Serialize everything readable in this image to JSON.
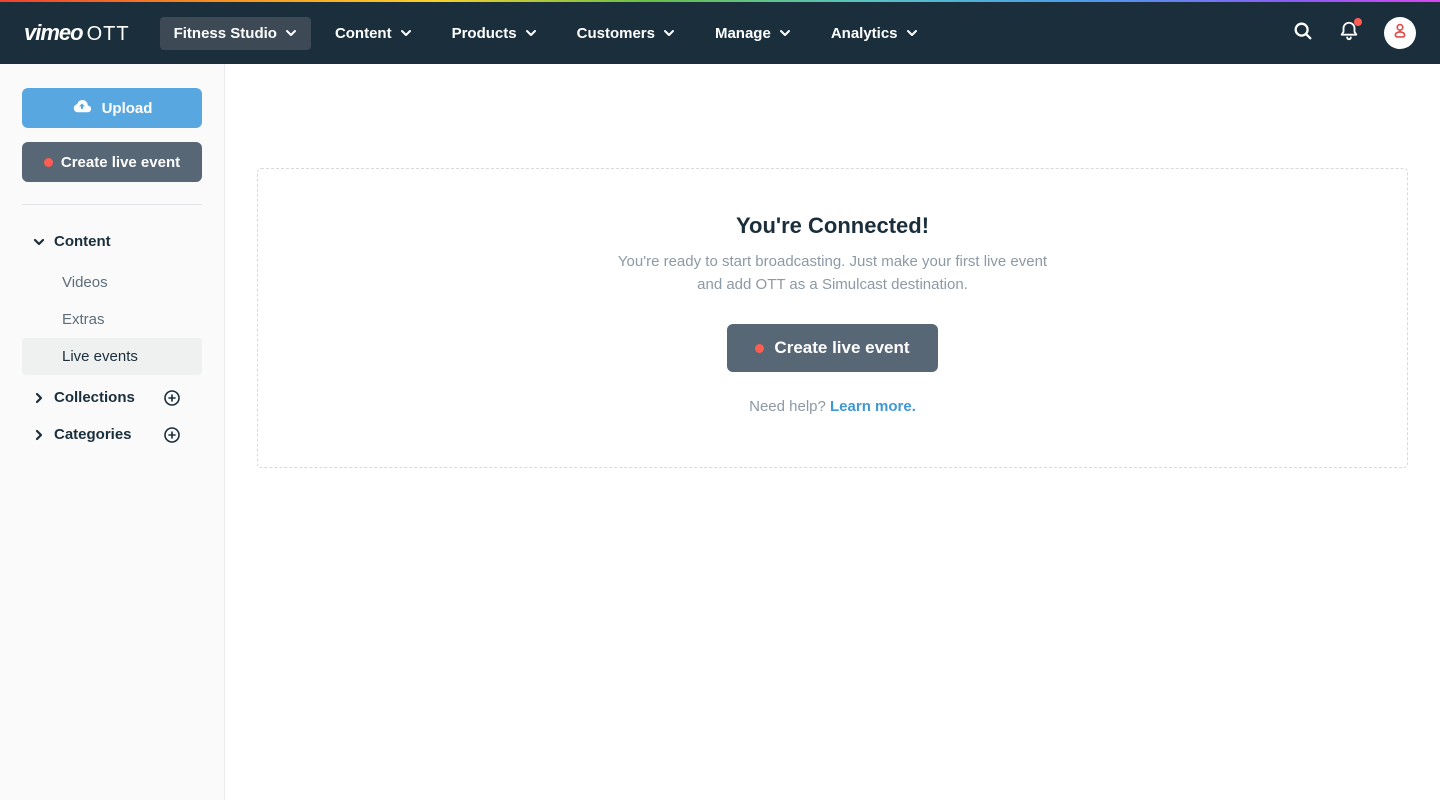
{
  "brand": {
    "name_main": "vimeo",
    "name_sub": "OTT"
  },
  "topnav": {
    "site_selector": "Fitness Studio",
    "items": [
      "Content",
      "Products",
      "Customers",
      "Manage",
      "Analytics"
    ]
  },
  "sidebar": {
    "upload_label": "Upload",
    "create_live_label": "Create live event",
    "sections": {
      "content": {
        "label": "Content",
        "expanded": true,
        "items": [
          {
            "label": "Videos",
            "active": false
          },
          {
            "label": "Extras",
            "active": false
          },
          {
            "label": "Live events",
            "active": true
          }
        ]
      },
      "collections": {
        "label": "Collections"
      },
      "categories": {
        "label": "Categories"
      }
    }
  },
  "main": {
    "title": "You're Connected!",
    "description": "You're ready to start broadcasting. Just make your first live event and add OTT as a Simulcast destination.",
    "cta_label": "Create live event",
    "help_prefix": "Need help? ",
    "help_link": "Learn more."
  }
}
